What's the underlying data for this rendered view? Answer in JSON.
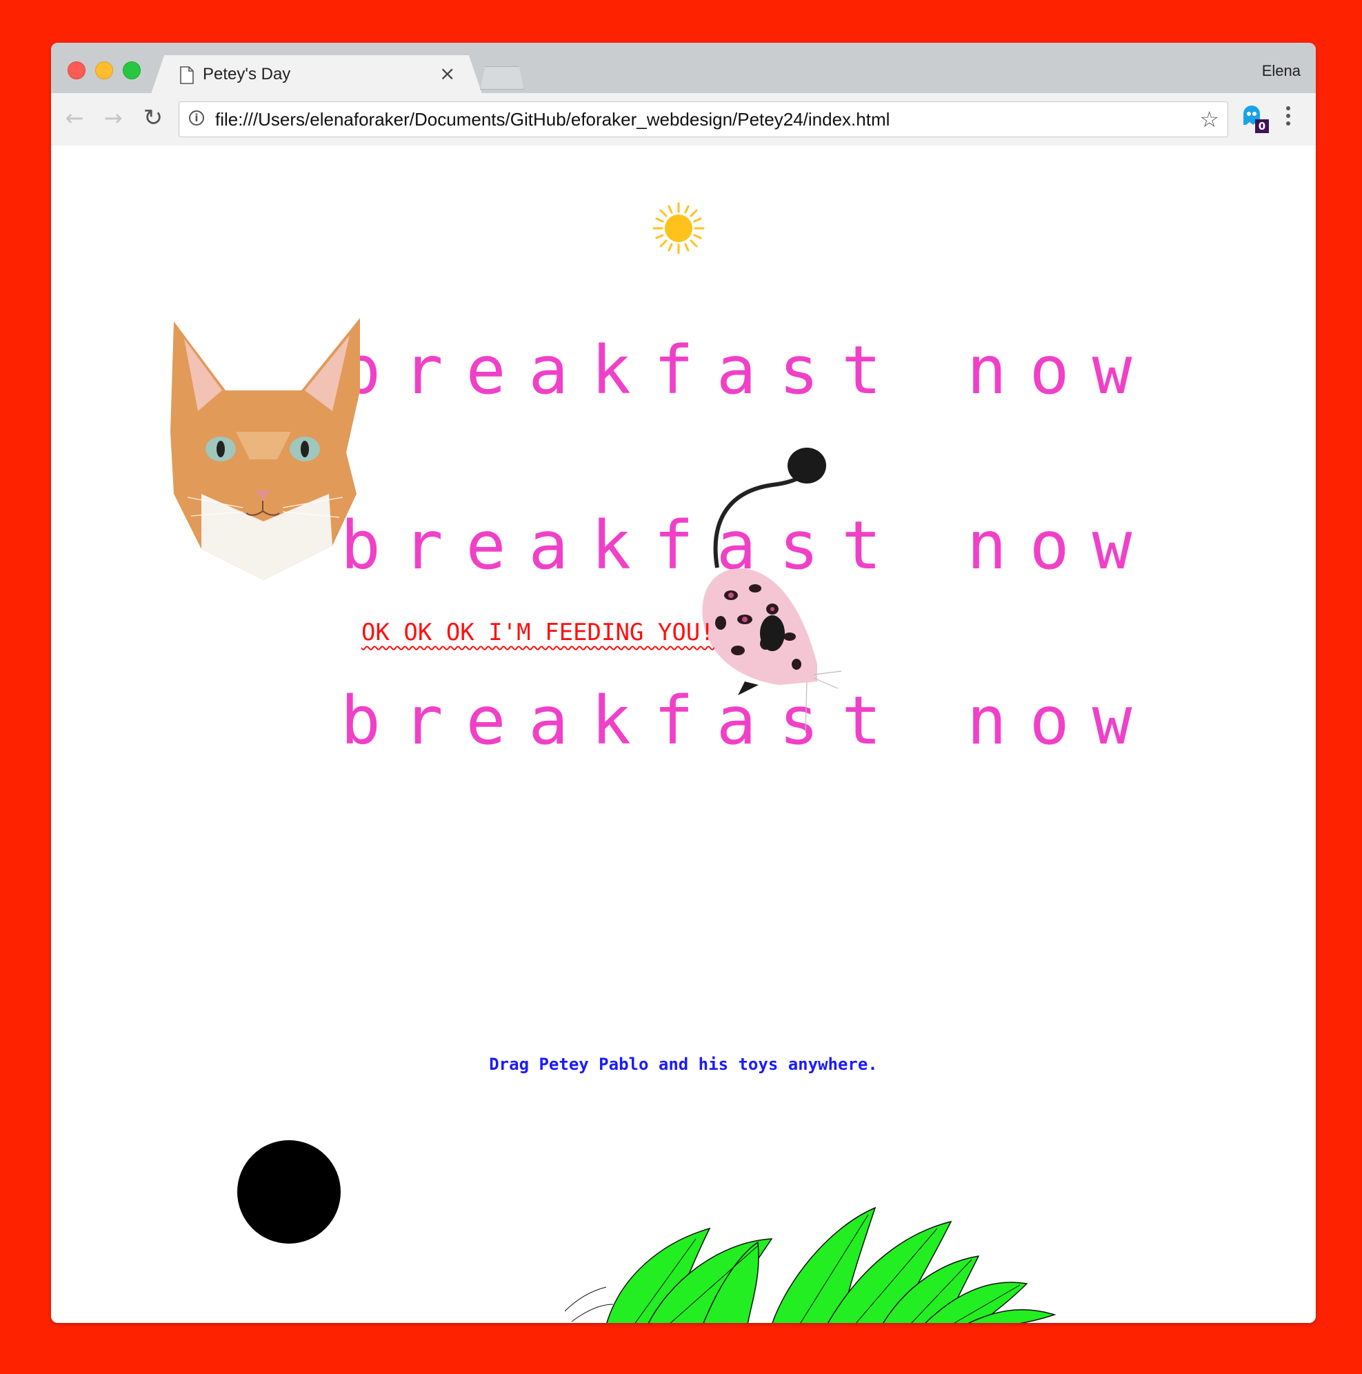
{
  "browser": {
    "tab_title": "Petey's Day",
    "tab_close_glyph": "×",
    "profile_name": "Elena",
    "url": "file:///Users/elenaforaker/Documents/GitHub/eforaker_webdesign/Petey24/index.html",
    "extension_badge": "0",
    "icons": [
      "back-icon",
      "forward-icon",
      "reload-icon",
      "info-icon",
      "star-icon",
      "ghost-extension-icon",
      "menu-icon"
    ]
  },
  "page": {
    "breakfast_lines": [
      "breakfast now",
      "breakfast now",
      "breakfast now"
    ],
    "feeding_text": "OK OK OK I'M FEEDING YOU!",
    "instruction": "Drag Petey Pablo and his toys anywhere.",
    "colors": {
      "background": "#ff2200",
      "breakfast": "#f040c8",
      "feeding": "#ff1010",
      "instruction": "#1a1aff",
      "plant": "#22ee22",
      "sun": "#ffc21a"
    }
  }
}
